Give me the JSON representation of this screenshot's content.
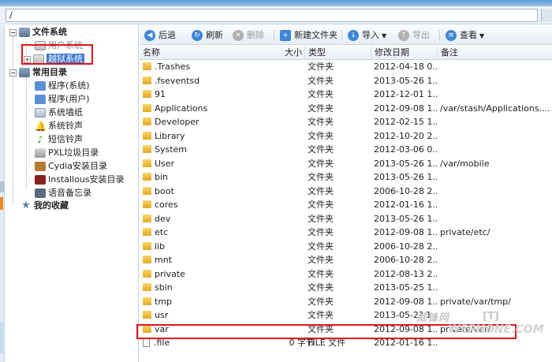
{
  "path": {
    "value": "/"
  },
  "tree": {
    "root": "文件系统",
    "root_children": [
      "用户系统",
      "越狱系统"
    ],
    "common": "常用目录",
    "common_children": [
      "程序(系统)",
      "程序(用户)",
      "系统墙纸",
      "系统铃声",
      "短信铃声",
      "PXL垃圾目录",
      "Cydia安装目录",
      "Installous安装目录",
      "语音备忘录"
    ],
    "favorites": "我的收藏"
  },
  "toolbar": {
    "back": "后退",
    "refresh": "刷新",
    "delete": "删除",
    "new_folder": "新建文件夹",
    "import": "导入",
    "export": "导出",
    "view": "查看"
  },
  "columns": {
    "name": "名称",
    "size": "大小",
    "type": "类型",
    "date": "修改日期",
    "note": "备注"
  },
  "files": [
    {
      "name": ".Trashes",
      "size": "",
      "type": "文件夹",
      "date": "2012-04-18 0...",
      "note": ""
    },
    {
      "name": ".fseventsd",
      "size": "",
      "type": "文件夹",
      "date": "2013-05-26 1...",
      "note": ""
    },
    {
      "name": "91",
      "size": "",
      "type": "文件夹",
      "date": "2012-12-01 1...",
      "note": ""
    },
    {
      "name": "Applications",
      "size": "",
      "type": "文件夹",
      "date": "2012-09-08 1...",
      "note": "/var/stash/Applications...."
    },
    {
      "name": "Developer",
      "size": "",
      "type": "文件夹",
      "date": "2012-02-15 1...",
      "note": ""
    },
    {
      "name": "Library",
      "size": "",
      "type": "文件夹",
      "date": "2012-10-20 2...",
      "note": ""
    },
    {
      "name": "System",
      "size": "",
      "type": "文件夹",
      "date": "2012-03-06 0...",
      "note": ""
    },
    {
      "name": "User",
      "size": "",
      "type": "文件夹",
      "date": "2013-05-26 1...",
      "note": "/var/mobile"
    },
    {
      "name": "bin",
      "size": "",
      "type": "文件夹",
      "date": "2013-05-26 1...",
      "note": ""
    },
    {
      "name": "boot",
      "size": "",
      "type": "文件夹",
      "date": "2006-10-28 2...",
      "note": ""
    },
    {
      "name": "cores",
      "size": "",
      "type": "文件夹",
      "date": "2012-01-16 1...",
      "note": ""
    },
    {
      "name": "dev",
      "size": "",
      "type": "文件夹",
      "date": "2013-05-26 1...",
      "note": ""
    },
    {
      "name": "etc",
      "size": "",
      "type": "文件夹",
      "date": "2012-09-08 1...",
      "note": "private/etc/"
    },
    {
      "name": "lib",
      "size": "",
      "type": "文件夹",
      "date": "2006-10-28 2...",
      "note": ""
    },
    {
      "name": "mnt",
      "size": "",
      "type": "文件夹",
      "date": "2006-10-28 2...",
      "note": ""
    },
    {
      "name": "private",
      "size": "",
      "type": "文件夹",
      "date": "2012-08-13 2...",
      "note": ""
    },
    {
      "name": "sbin",
      "size": "",
      "type": "文件夹",
      "date": "2013-05-25 1...",
      "note": ""
    },
    {
      "name": "tmp",
      "size": "",
      "type": "文件夹",
      "date": "2012-09-08 1...",
      "note": "private/var/tmp/"
    },
    {
      "name": "usr",
      "size": "",
      "type": "文件夹",
      "date": "2013-05-2? 1...",
      "note": ""
    },
    {
      "name": "var",
      "size": "",
      "type": "文件夹",
      "date": "2012-09-08 1...",
      "note": "private/var/"
    },
    {
      "name": ".file",
      "size": "0 字节",
      "type": "FILE 文件",
      "date": "2012-01-16 1...",
      "note": ""
    }
  ],
  "watermark": {
    "text1": "威锋网",
    "text2": "WEPHONE.COM",
    "text3": "[T]"
  },
  "colors": {
    "highlight": "#e0161b",
    "selection": "#3a78c9",
    "folder": "#e5a920"
  }
}
